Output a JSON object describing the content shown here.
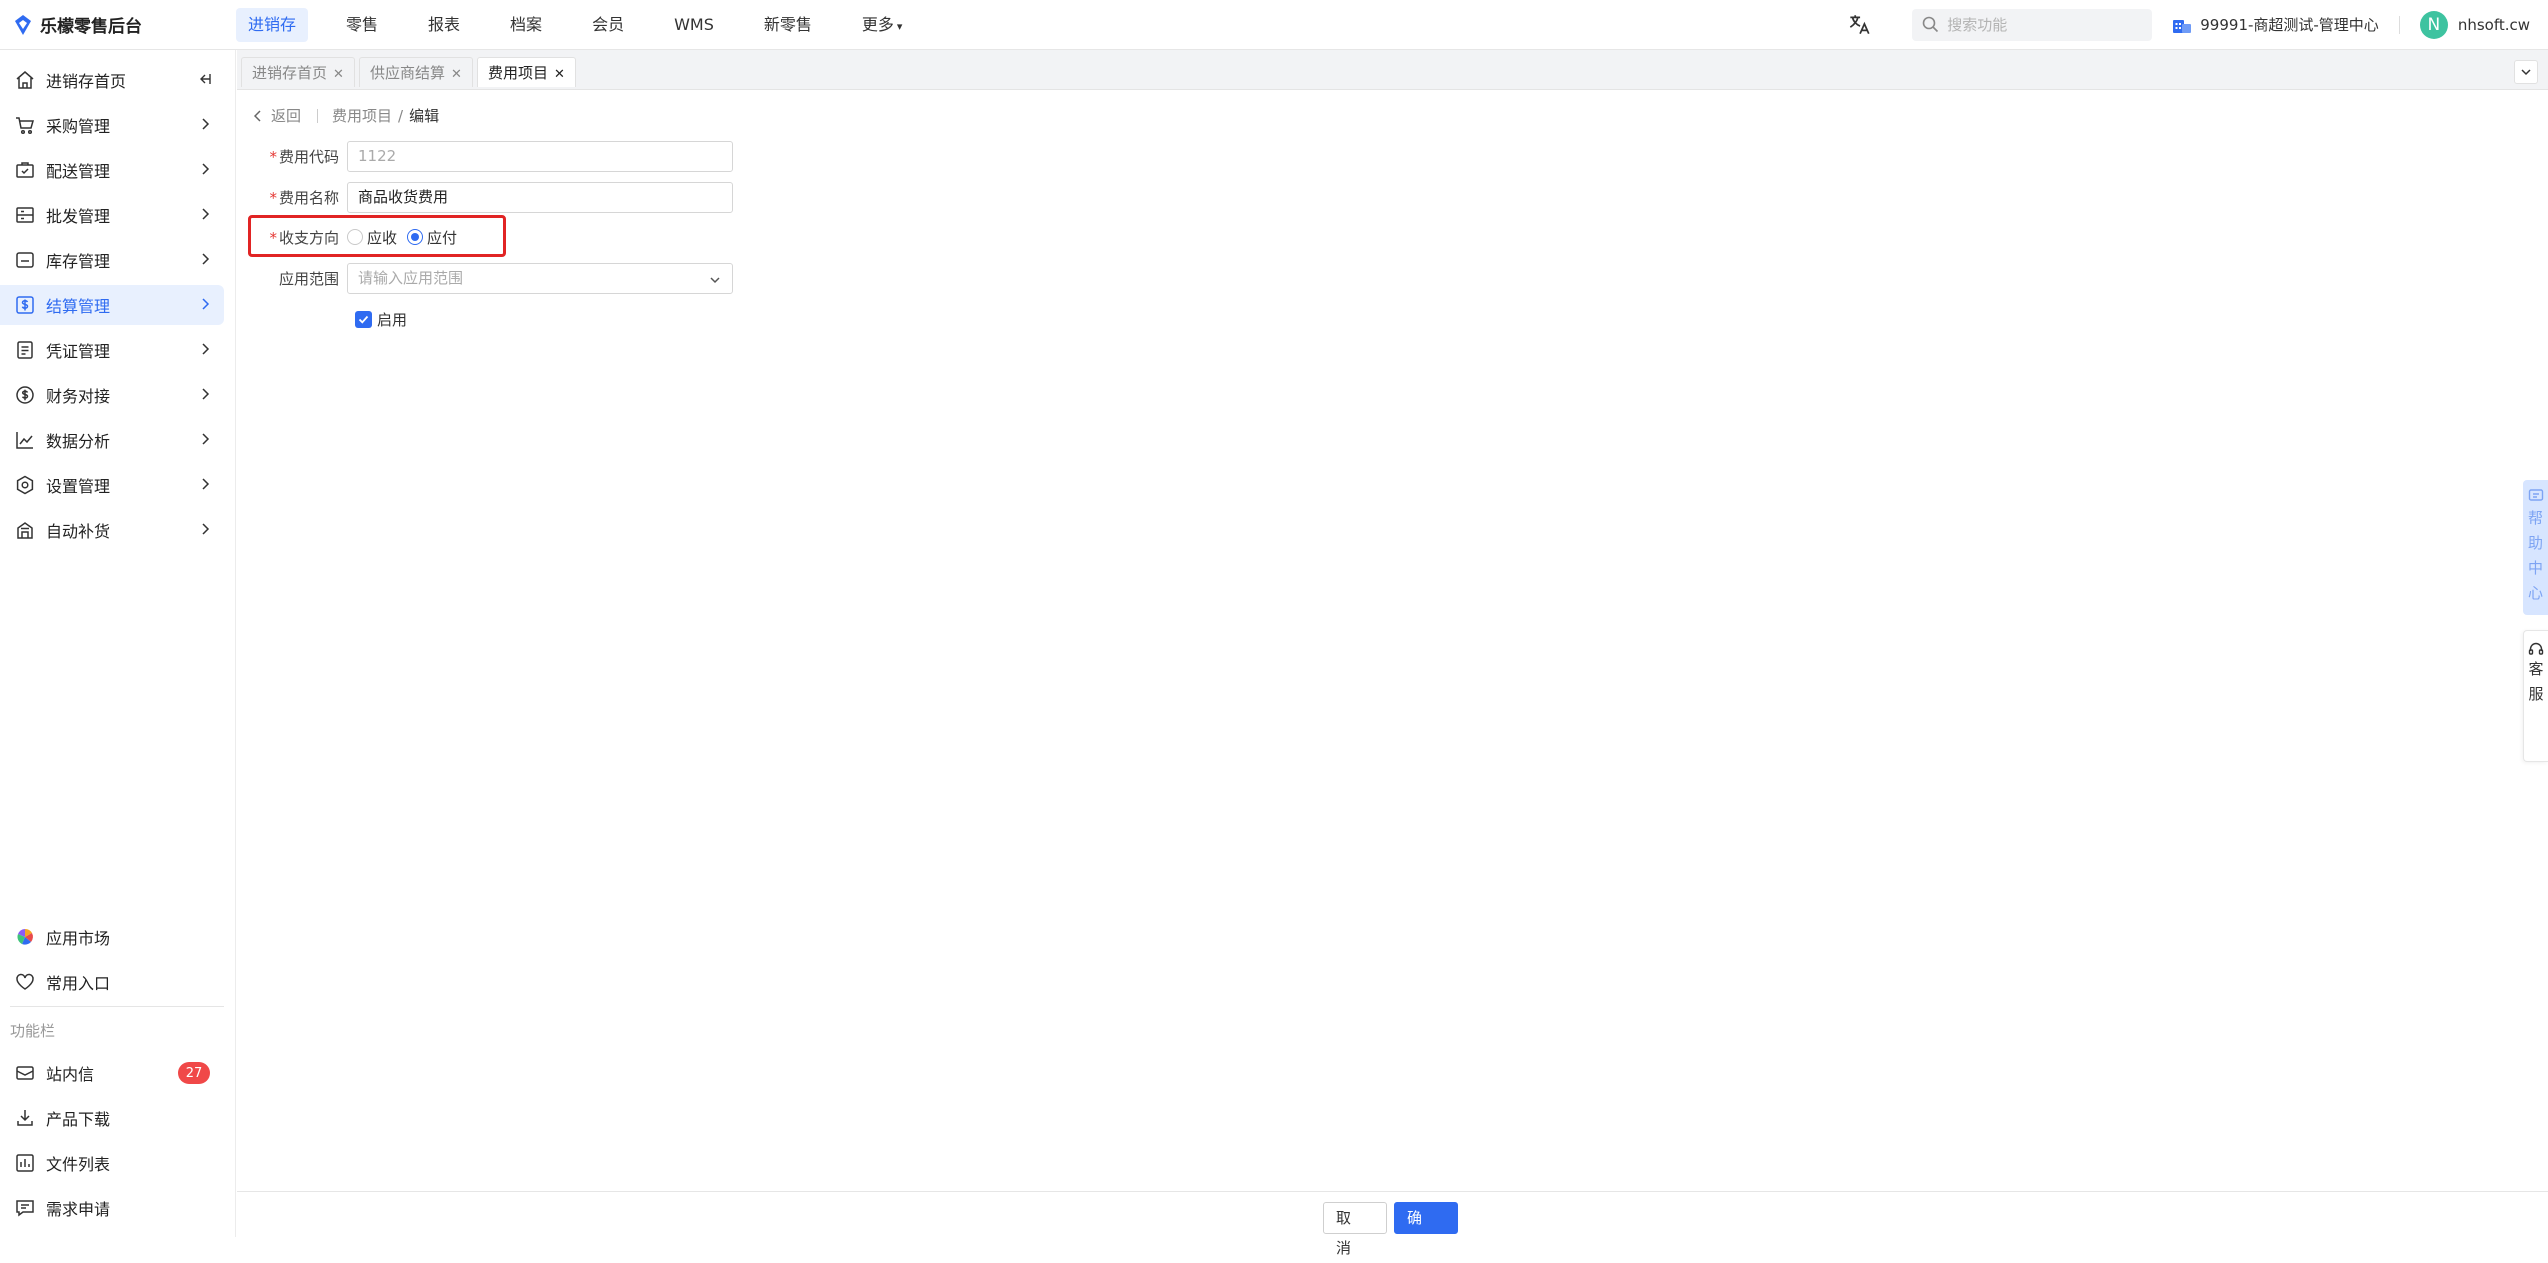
{
  "app": {
    "title": "乐檬零售后台"
  },
  "topnav": {
    "items": [
      "进销存",
      "零售",
      "报表",
      "档案",
      "会员",
      "WMS",
      "新零售",
      "更多"
    ],
    "active_index": 0
  },
  "header": {
    "search_placeholder": "搜索功能",
    "store": "99991-商超测试-管理中心",
    "avatar_letter": "N",
    "username": "nhsoft.cw"
  },
  "sidebar": {
    "items": [
      {
        "label": "进销存首页",
        "icon": "home-icon"
      },
      {
        "label": "采购管理",
        "icon": "cart-icon"
      },
      {
        "label": "配送管理",
        "icon": "delivery-icon"
      },
      {
        "label": "批发管理",
        "icon": "wholesale-icon"
      },
      {
        "label": "库存管理",
        "icon": "inventory-icon"
      },
      {
        "label": "结算管理",
        "icon": "settlement-icon"
      },
      {
        "label": "凭证管理",
        "icon": "voucher-icon"
      },
      {
        "label": "财务对接",
        "icon": "finance-icon"
      },
      {
        "label": "数据分析",
        "icon": "chart-icon"
      },
      {
        "label": "设置管理",
        "icon": "settings-icon"
      },
      {
        "label": "自动补货",
        "icon": "replenish-icon"
      }
    ],
    "active_index": 5,
    "bottom": {
      "app_market": "应用市场",
      "common_entry": "常用入口",
      "section_label": "功能栏",
      "messages": "站内信",
      "messages_badge": "27",
      "download": "产品下载",
      "files": "文件列表",
      "requests": "需求申请"
    }
  },
  "tabs": [
    {
      "label": "进销存首页",
      "active": false
    },
    {
      "label": "供应商结算",
      "active": false
    },
    {
      "label": "费用项目",
      "active": true
    }
  ],
  "breadcrumb": {
    "back": "返回",
    "parent": "费用项目",
    "separator": "/",
    "current": "编辑"
  },
  "form": {
    "code_label": "费用代码",
    "code_value": "1122",
    "name_label": "费用名称",
    "name_value": "商品收货费用",
    "direction_label": "收支方向",
    "direction_options": [
      "应收",
      "应付"
    ],
    "direction_selected": "应付",
    "scope_label": "应用范围",
    "scope_placeholder": "请输入应用范围",
    "enable_label": "启用",
    "enable_checked": true
  },
  "footer": {
    "cancel": "取 消",
    "ok": "确 定"
  },
  "floating": {
    "help": [
      "帮",
      "助",
      "中",
      "心"
    ],
    "service": [
      "客",
      "服"
    ]
  },
  "colors": {
    "primary": "#2f6bf1",
    "highlight_border": "#e12424",
    "badge": "#f04848"
  }
}
